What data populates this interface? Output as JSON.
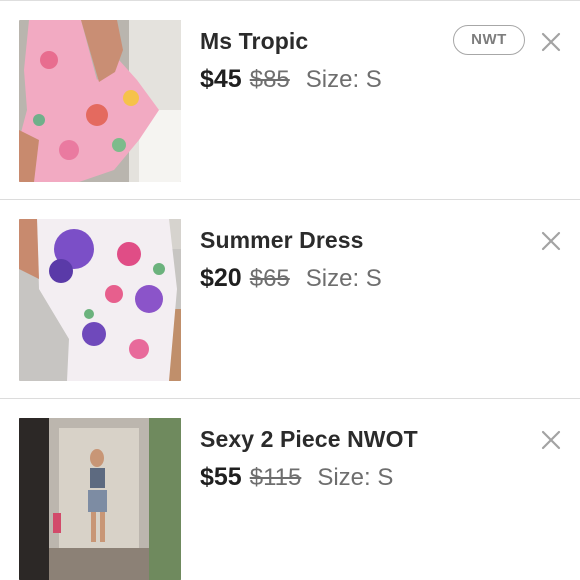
{
  "listings": [
    {
      "title": "Ms Tropic",
      "price": "$45",
      "original_price": "$85",
      "size": "Size: S",
      "badge": "NWT",
      "close_icon": "close-icon"
    },
    {
      "title": "Summer Dress",
      "price": "$20",
      "original_price": "$65",
      "size": "Size: S",
      "close_icon": "close-icon"
    },
    {
      "title": "Sexy 2 Piece NWOT",
      "price": "$55",
      "original_price": "$115",
      "size": "Size: S",
      "close_icon": "close-icon"
    }
  ],
  "colors": {
    "title": "#2b2b2b",
    "muted": "#6e6e6e",
    "badge_border": "#a7a7a7",
    "divider": "#dcdcdc"
  }
}
